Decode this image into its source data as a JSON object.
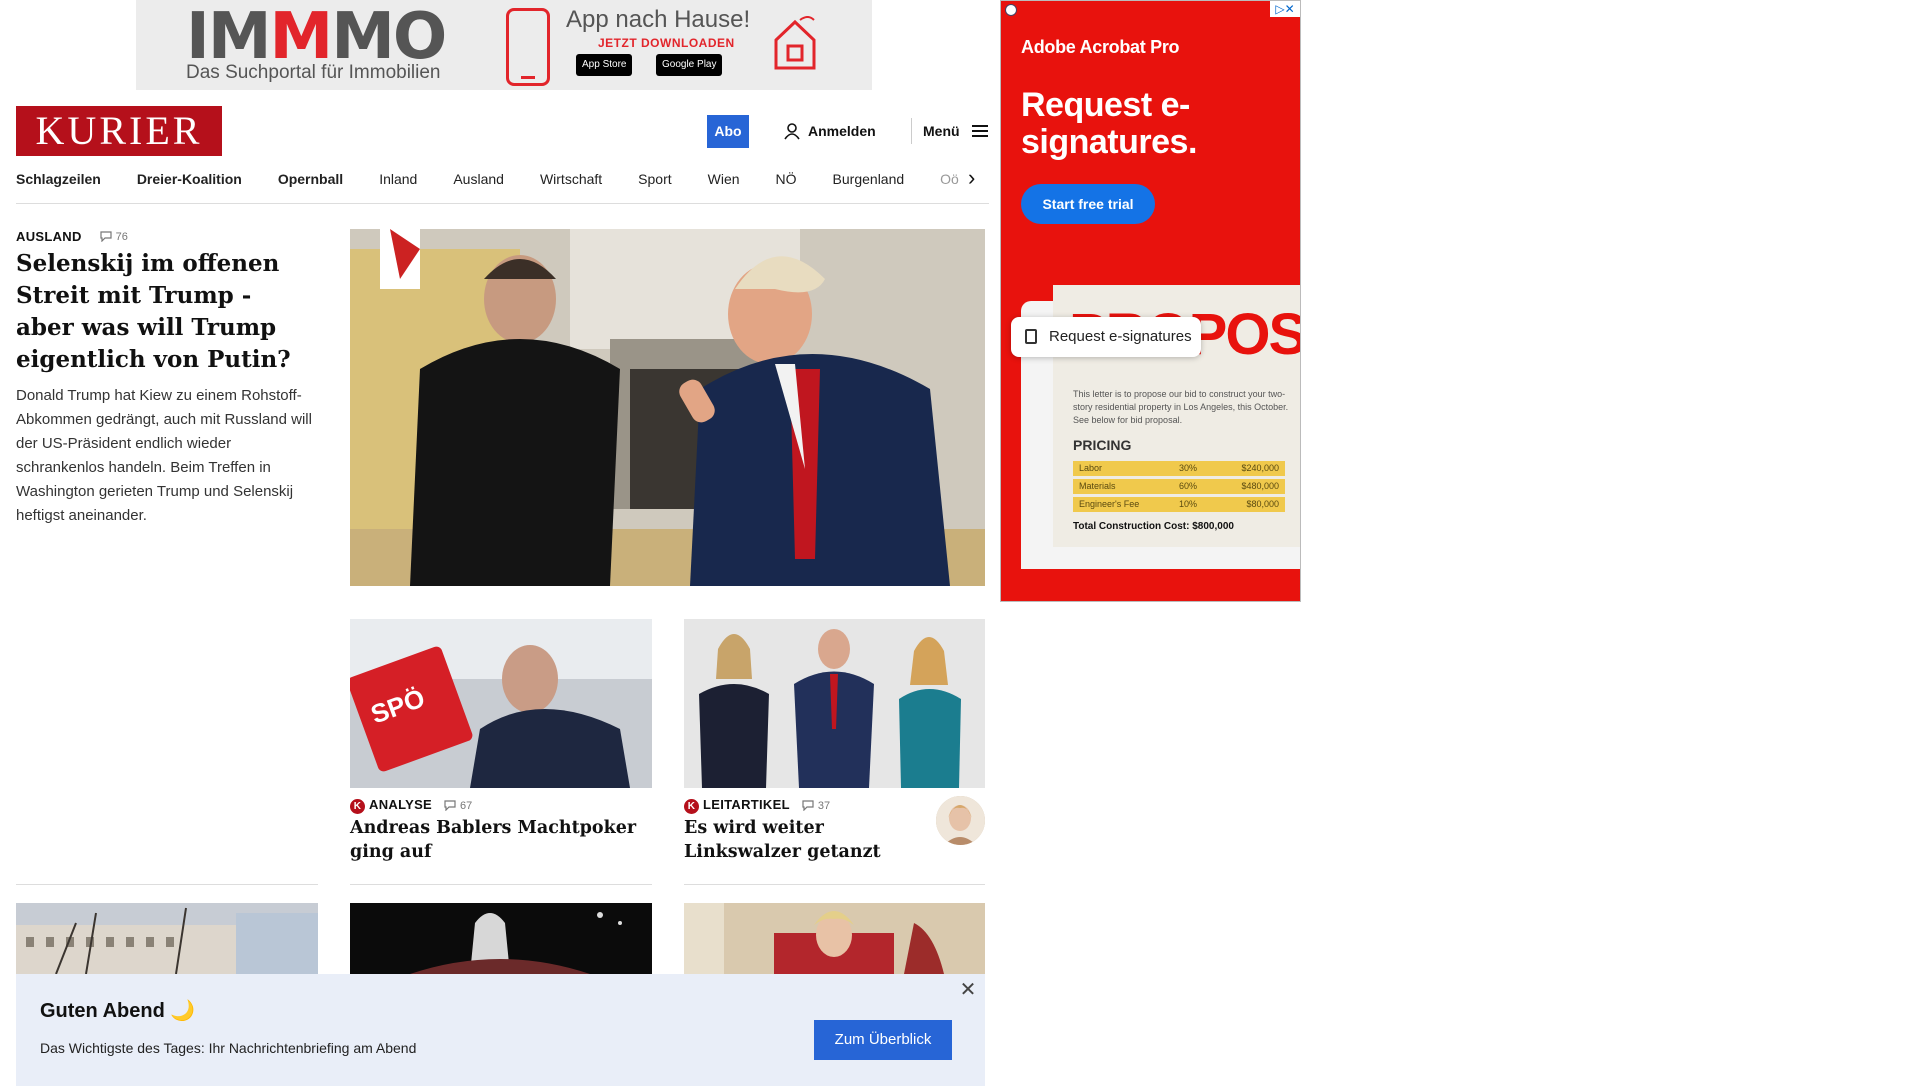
{
  "top_ad": {
    "brand_pre": "IM",
    "brand_red": "M",
    "brand_post": "MO",
    "tagline": "Das Suchportal für Immobilien",
    "app_text": "App nach Hause!",
    "download": "JETZT DOWNLOADEN",
    "appstore": "App Store",
    "googleplay": "Google Play"
  },
  "header": {
    "logo": "KURIER",
    "abo": "Abo",
    "login": "Anmelden",
    "menu": "Menü"
  },
  "nav": {
    "items": [
      "Schlagzeilen",
      "Dreier-Koalition",
      "Opernball",
      "Inland",
      "Ausland",
      "Wirtschaft",
      "Sport",
      "Wien",
      "NÖ",
      "Burgenland",
      "Oö"
    ]
  },
  "lead": {
    "kicker": "AUSLAND",
    "comments": "76",
    "title": "Selenskij im offenen Streit mit Trump - aber was will Trump eigentlich von Putin?",
    "text": "Donald Trump hat Kiew zu einem Rohstoff-Abkommen gedrängt, auch mit Russland will der US-Präsident endlich wieder schrankenlos handeln. Beim Treffen in Washington gerieten Trump und Selenskij heftigst aneinander."
  },
  "cards": [
    {
      "kicker": "ANALYSE",
      "comments": "67",
      "title": "Andreas Bablers Machtpoker ging auf"
    },
    {
      "kicker": "LEITARTIKEL",
      "comments": "37",
      "title": "Es wird weiter Linkswalzer getanzt"
    }
  ],
  "right_ad": {
    "brand": "Adobe Acrobat Pro",
    "headline": "Request e-signatures.",
    "cta": "Start free trial",
    "proposal": "PROPOSAL",
    "paper_text": "This letter is to propose our bid to construct your two-story residential property in Los Angeles, this October. See below for bid proposal.",
    "pricing": "PRICING",
    "rows": [
      {
        "name": "Labor",
        "pct": "30%",
        "amount": "$240,000"
      },
      {
        "name": "Materials",
        "pct": "60%",
        "amount": "$480,000"
      },
      {
        "name": "Engineer's Fee",
        "pct": "10%",
        "amount": "$80,000"
      }
    ],
    "total": "Total Construction Cost: $800,000",
    "pill": "Request e-signatures"
  },
  "bottom_banner": {
    "title": "Guten Abend 🌙",
    "text": "Das Wichtigste des Tages: Ihr Nachrichtenbriefing am Abend",
    "button": "Zum Überblick"
  },
  "colors": {
    "kurier_red": "#b5101b",
    "abo_blue": "#2765d6",
    "adobe_red": "#e8120d",
    "banner_bg": "#e9eef8"
  }
}
